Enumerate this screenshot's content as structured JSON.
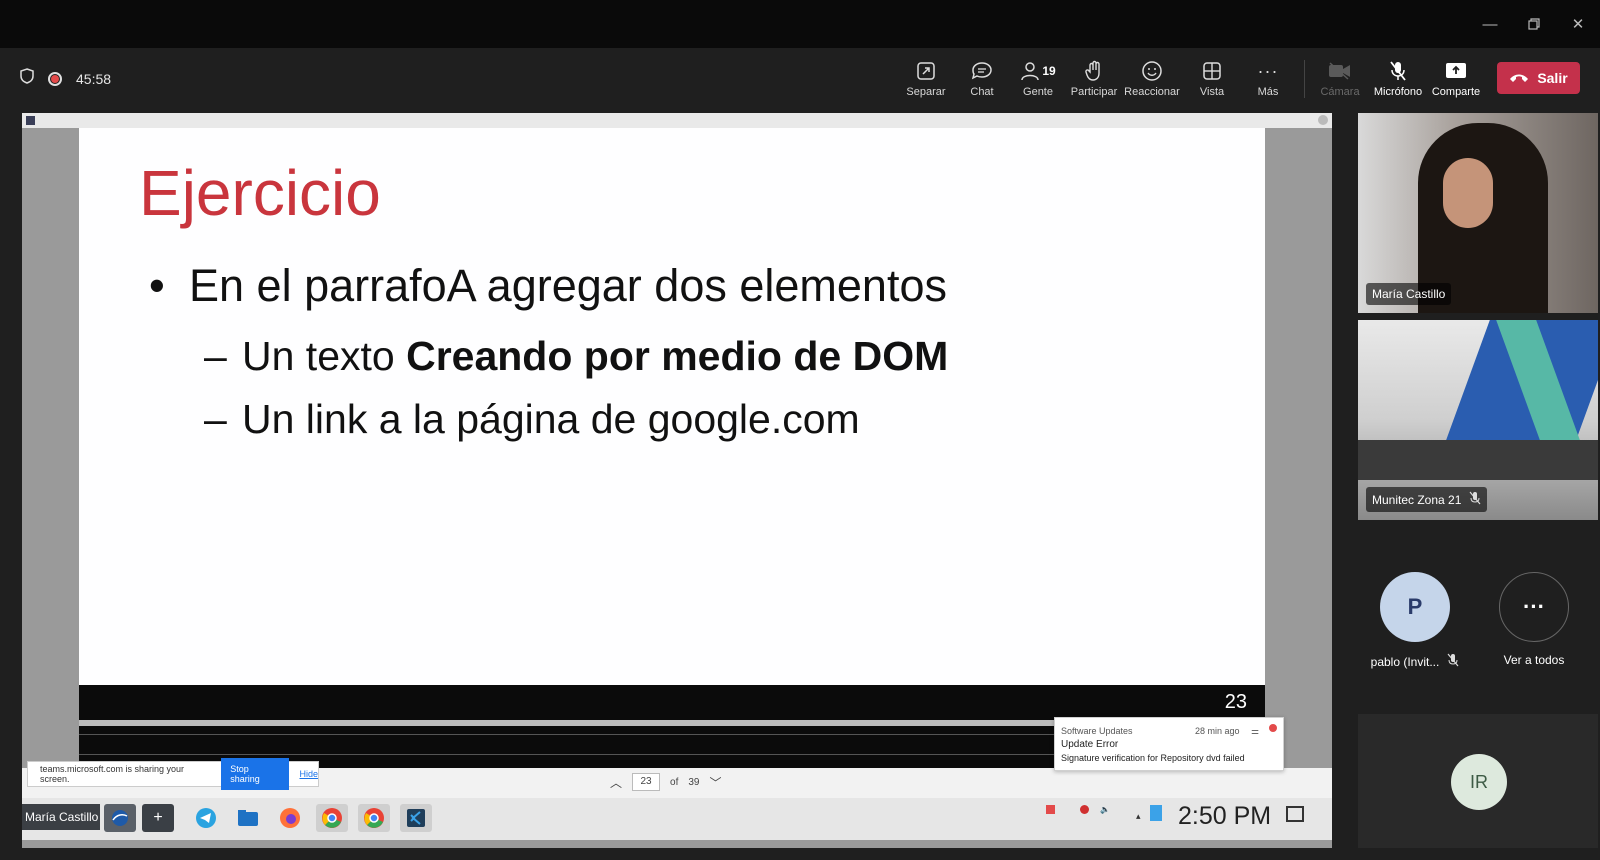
{
  "meeting": {
    "timer": "45:58",
    "toolbar": {
      "separar": "Separar",
      "chat": "Chat",
      "gente": "Gente",
      "gente_count": "19",
      "participar": "Participar",
      "reaccionar": "Reaccionar",
      "vista": "Vista",
      "mas": "Más",
      "camara": "Cámara",
      "microfono": "Micrófono",
      "comparte": "Comparte",
      "salir": "Salir"
    },
    "colors": {
      "leave": "#c4314b",
      "title_accent": "#c9353d"
    }
  },
  "slide": {
    "title": "Ejercicio",
    "bullet": "En el parrafoA agregar dos elementos",
    "sub1_prefix": "Un texto ",
    "sub1_bold": "Creando por medio de DOM",
    "sub2": "Un link a la página de google.com",
    "number": "23",
    "page_current": "23",
    "page_of": "of",
    "page_total": "39"
  },
  "share_banner": {
    "message": "teams.microsoft.com is sharing your screen.",
    "stop": "Stop sharing",
    "hide": "Hide"
  },
  "notification": {
    "app": "Software Updates",
    "time": "28 min ago",
    "title": "Update Error",
    "body": "Signature verification for Repository dvd failed"
  },
  "taskbar": {
    "user": "María Castillo",
    "clock": "2:50 PM"
  },
  "participants": [
    {
      "name": "María Castillo"
    },
    {
      "name": "Munitec Zona 21"
    },
    {
      "name": "pablo (Invit...",
      "initial": "P"
    },
    {
      "name": "Ver a todos"
    },
    {
      "initials": "IR"
    }
  ]
}
